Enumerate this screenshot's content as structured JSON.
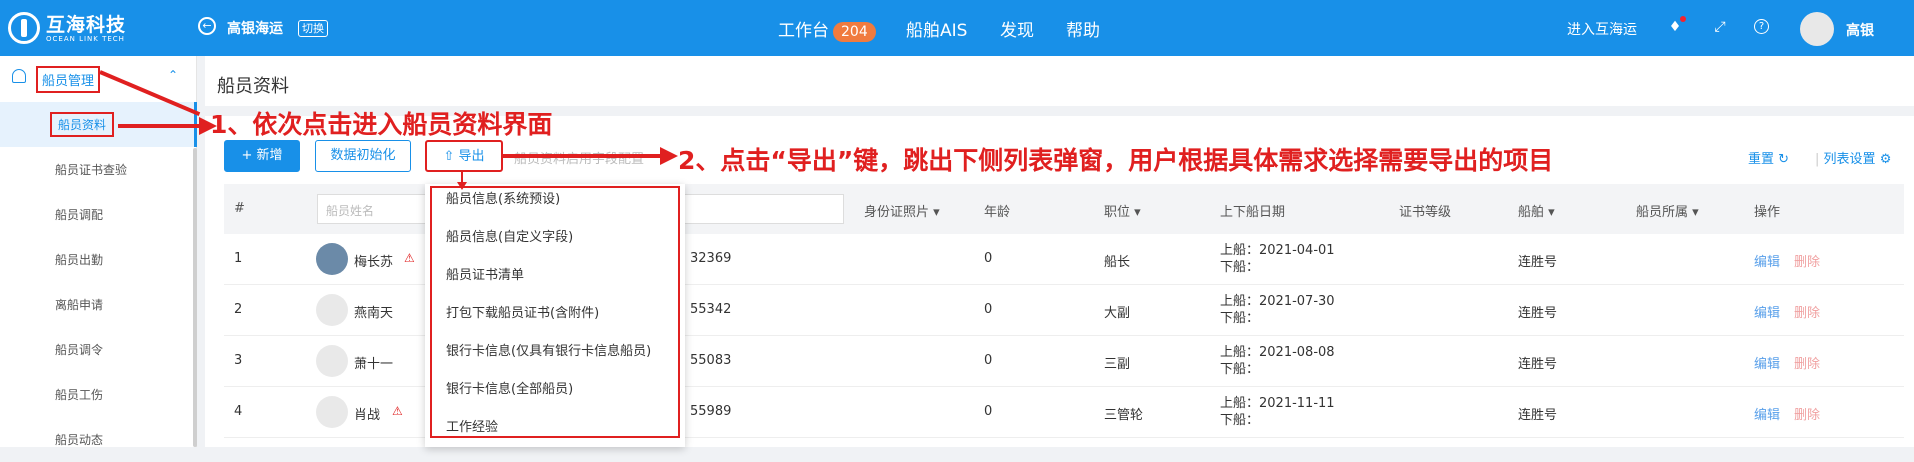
{
  "topbar": {
    "logo_cn": "互海科技",
    "logo_en": "OCEAN LINK TECH",
    "company": "高银海运",
    "switch_label": "切换",
    "nav": [
      {
        "label": "工作台",
        "badge": "204"
      },
      {
        "label": "船舶AIS"
      },
      {
        "label": "发现"
      },
      {
        "label": "帮助"
      }
    ],
    "enter_label": "进入互海运",
    "username": "高银",
    "icons": [
      "bell-icon",
      "fullscreen-icon",
      "help-icon"
    ]
  },
  "sidebar": {
    "group_label": "船员管理",
    "items": [
      "船员资料",
      "船员证书查验",
      "船员调配",
      "船员出勤",
      "离船申请",
      "船员调令",
      "船员工伤",
      "船员动态"
    ],
    "active_index": 0
  },
  "main": {
    "title": "船员资料",
    "buttons": {
      "add": "+ 新增",
      "init": "数据初始化",
      "export": "导出"
    },
    "hint": "船员资料启用字段配置",
    "reset": "重置",
    "column_settings": "列表设置",
    "columns": [
      "#",
      "船员姓名",
      "身份证照片",
      "年龄",
      "职位",
      "上下船日期",
      "证书等级",
      "船舶",
      "船员所属",
      "操作"
    ],
    "name_placeholder": "船员姓名",
    "rows": [
      {
        "index": "1",
        "name": "梅长苏",
        "warn": true,
        "id_tail": "32369",
        "age": "0",
        "position": "船长",
        "on_label": "上船：",
        "on_date": "2021-04-01",
        "off_label": "下船：",
        "ship": "连胜号",
        "edit": "编辑",
        "delete": "删除"
      },
      {
        "index": "2",
        "name": "燕南天",
        "warn": false,
        "id_tail": "55342",
        "age": "0",
        "position": "大副",
        "on_label": "上船：",
        "on_date": "2021-07-30",
        "off_label": "下船：",
        "ship": "连胜号",
        "edit": "编辑",
        "delete": "删除"
      },
      {
        "index": "3",
        "name": "萧十一",
        "warn": false,
        "id_tail": "55083",
        "age": "0",
        "position": "三副",
        "on_label": "上船：",
        "on_date": "2021-08-08",
        "off_label": "下船：",
        "ship": "连胜号",
        "edit": "编辑",
        "delete": "删除"
      },
      {
        "index": "4",
        "name": "肖战",
        "warn": true,
        "id_tail": "55989",
        "age": "0",
        "position": "三管轮",
        "on_label": "上船：",
        "on_date": "2021-11-11",
        "off_label": "下船：",
        "ship": "连胜号",
        "edit": "编辑",
        "delete": "删除"
      }
    ]
  },
  "export_menu": {
    "items": [
      "船员信息(系统预设)",
      "船员信息(自定义字段)",
      "船员证书清单",
      "打包下载船员证书(含附件)",
      "银行卡信息(仅具有银行卡信息船员)",
      "银行卡信息(全部船员)",
      "工作经验"
    ]
  },
  "annotations": {
    "step1": "1、依次点击进入船员资料界面",
    "step2": "2、点击“导出”键，跳出下侧列表弹窗，用户根据具体需求选择需要导出的项目"
  },
  "colors": {
    "primary": "#1890e8",
    "annotation": "#e02020",
    "badge": "#f07b3f"
  }
}
